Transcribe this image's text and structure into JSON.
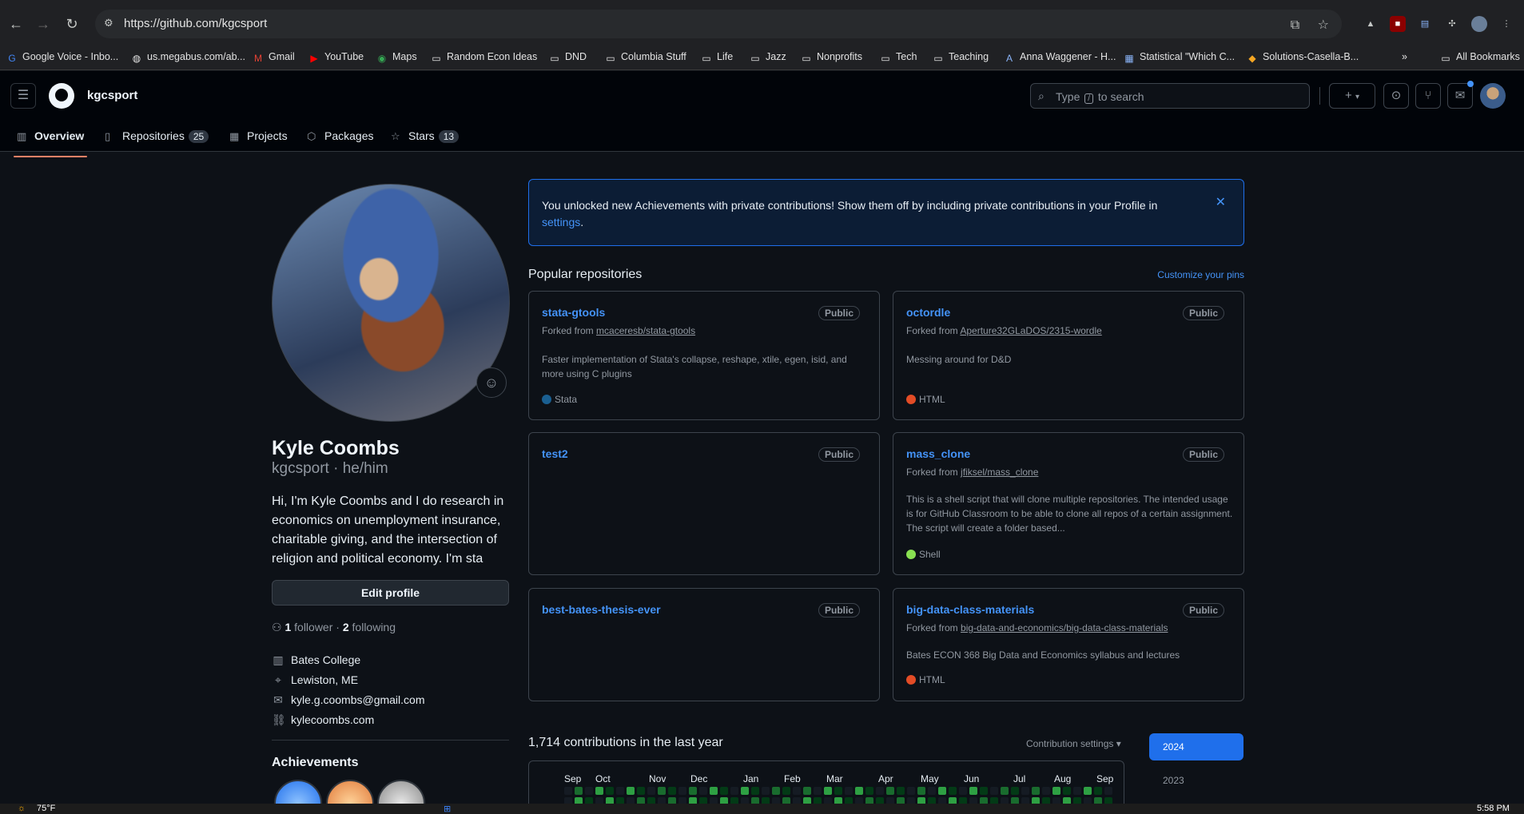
{
  "browser": {
    "url": "https://github.com/kgcsport",
    "bookmarks": [
      {
        "label": "Google Voice - Inbo...",
        "icon": "google-icon"
      },
      {
        "label": "us.megabus.com/ab...",
        "icon": "globe-icon"
      },
      {
        "label": "Gmail",
        "icon": "gmail-icon"
      },
      {
        "label": "YouTube",
        "icon": "youtube-icon"
      },
      {
        "label": "Maps",
        "icon": "maps-icon"
      },
      {
        "label": "Random Econ Ideas",
        "icon": "folder-icon"
      },
      {
        "label": "DND",
        "icon": "folder-icon"
      },
      {
        "label": "Columbia Stuff",
        "icon": "folder-icon"
      },
      {
        "label": "Life",
        "icon": "folder-icon"
      },
      {
        "label": "Jazz",
        "icon": "folder-icon"
      },
      {
        "label": "Nonprofits",
        "icon": "folder-icon"
      },
      {
        "label": "Tech",
        "icon": "folder-icon"
      },
      {
        "label": "Teaching",
        "icon": "folder-icon"
      },
      {
        "label": "Anna Waggener - H...",
        "icon": "site-icon"
      },
      {
        "label": "Statistical \"Which C...",
        "icon": "site-icon"
      },
      {
        "label": "Solutions-Casella-B...",
        "icon": "site-icon"
      }
    ],
    "more_bookmarks": "»",
    "all_bookmarks": "All Bookmarks"
  },
  "header": {
    "username": "kgcsport",
    "search_placeholder_pre": "Type",
    "search_slash": "/",
    "search_placeholder_post": "to search",
    "plus": "+",
    "tabs": [
      {
        "label": "Overview",
        "count": ""
      },
      {
        "label": "Repositories",
        "count": "25"
      },
      {
        "label": "Projects",
        "count": ""
      },
      {
        "label": "Packages",
        "count": ""
      },
      {
        "label": "Stars",
        "count": "13"
      }
    ]
  },
  "profile": {
    "name": "Kyle Coombs",
    "login_line": "kgcsport · he/him",
    "bio": "Hi, I'm Kyle Coombs and I do research in economics on unemployment insurance, charitable giving, and the intersection of religion and political economy. I'm sta",
    "edit_button": "Edit profile",
    "followers_count": "1",
    "followers_label": "follower",
    "sep": "·",
    "following_count": "2",
    "following_label": "following",
    "org": "Bates College",
    "location": "Lewiston, ME",
    "email": "kyle.g.coombs@gmail.com",
    "website": "kylecoombs.com",
    "achievements_title": "Achievements"
  },
  "banner": {
    "text": "You unlocked new Achievements with private contributions! Show them off by including private contributions in your Profile in",
    "link": "settings",
    "period": "."
  },
  "popular": {
    "title": "Popular repositories",
    "customize": "Customize your pins",
    "repos": [
      {
        "name": "stata-gtools",
        "visibility": "Public",
        "forked_prefix": "Forked from",
        "forked_from": "mcaceresb/stata-gtools",
        "description": "Faster implementation of Stata's collapse, reshape, xtile, egen, isid, and more using C plugins",
        "language": "Stata",
        "lang_color": "#1a5f91"
      },
      {
        "name": "octordle",
        "visibility": "Public",
        "forked_prefix": "Forked from",
        "forked_from": "Aperture32GLaDOS/2315-wordle",
        "description": "Messing around for D&D",
        "language": "HTML",
        "lang_color": "#e34c26"
      },
      {
        "name": "test2",
        "visibility": "Public",
        "forked_prefix": "",
        "forked_from": "",
        "description": "",
        "language": "",
        "lang_color": ""
      },
      {
        "name": "mass_clone",
        "visibility": "Public",
        "forked_prefix": "Forked from",
        "forked_from": "jfiksel/mass_clone",
        "description": "This is a shell script that will clone multiple repositories. The intended usage is for GitHub Classroom to be able to clone all repos of a certain assignment. The script will create a folder based...",
        "language": "Shell",
        "lang_color": "#89e051"
      },
      {
        "name": "best-bates-thesis-ever",
        "visibility": "Public",
        "forked_prefix": "",
        "forked_from": "",
        "description": "",
        "language": "",
        "lang_color": ""
      },
      {
        "name": "big-data-class-materials",
        "visibility": "Public",
        "forked_prefix": "Forked from",
        "forked_from": "big-data-and-economics/big-data-class-materials",
        "description": "Bates ECON 368 Big Data and Economics syllabus and lectures",
        "language": "HTML",
        "lang_color": "#e34c26"
      }
    ]
  },
  "contributions": {
    "title": "1,714 contributions in the last year",
    "settings": "Contribution settings ▾",
    "months": [
      "Sep",
      "Oct",
      "Nov",
      "Dec",
      "Jan",
      "Feb",
      "Mar",
      "Apr",
      "May",
      "Jun",
      "Jul",
      "Aug",
      "Sep"
    ],
    "years": [
      "2024",
      "2023"
    ]
  },
  "taskbar": {
    "temp": "75°F",
    "time": "5:58 PM"
  },
  "colors": {
    "accent": "#4493f8",
    "tab_underline": "#f78166",
    "year_active": "#1f6feb"
  }
}
